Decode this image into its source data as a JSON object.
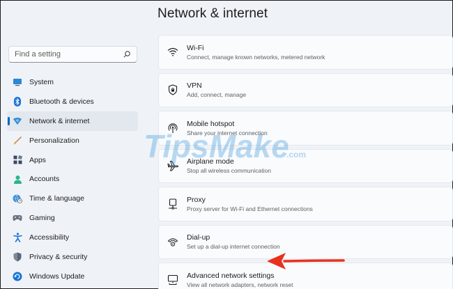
{
  "header": {
    "title": "Network & internet"
  },
  "search": {
    "placeholder": "Find a setting"
  },
  "sidebar": {
    "items": [
      {
        "label": "System",
        "icon": "monitor-icon"
      },
      {
        "label": "Bluetooth & devices",
        "icon": "bluetooth-icon"
      },
      {
        "label": "Network & internet",
        "icon": "wifi-diamond-icon",
        "selected": true
      },
      {
        "label": "Personalization",
        "icon": "brush-icon"
      },
      {
        "label": "Apps",
        "icon": "apps-icon"
      },
      {
        "label": "Accounts",
        "icon": "person-icon"
      },
      {
        "label": "Time & language",
        "icon": "globe-clock-icon"
      },
      {
        "label": "Gaming",
        "icon": "gamepad-icon"
      },
      {
        "label": "Accessibility",
        "icon": "accessibility-icon"
      },
      {
        "label": "Privacy & security",
        "icon": "shield-icon"
      },
      {
        "label": "Windows Update",
        "icon": "update-icon"
      }
    ]
  },
  "cards": [
    {
      "title": "Wi-Fi",
      "subtitle": "Connect, manage known networks, metered network",
      "icon": "wifi-icon"
    },
    {
      "title": "VPN",
      "subtitle": "Add, connect, manage",
      "icon": "vpn-shield-icon"
    },
    {
      "title": "Mobile hotspot",
      "subtitle": "Share your internet connection",
      "icon": "hotspot-icon"
    },
    {
      "title": "Airplane mode",
      "subtitle": "Stop all wireless communication",
      "icon": "airplane-icon"
    },
    {
      "title": "Proxy",
      "subtitle": "Proxy server for Wi-Fi and Ethernet connections",
      "icon": "proxy-icon"
    },
    {
      "title": "Dial-up",
      "subtitle": "Set up a dial-up internet connection",
      "icon": "dialup-icon"
    },
    {
      "title": "Advanced network settings",
      "subtitle": "View all network adapters, network reset",
      "icon": "network-adapter-icon"
    }
  ],
  "watermark": {
    "text": "TipsMake",
    "suffix": ".com"
  },
  "colors": {
    "accent": "#0067c0",
    "arrow": "#e8321f",
    "background": "#eff3f8",
    "card": "#f9fbfd"
  }
}
